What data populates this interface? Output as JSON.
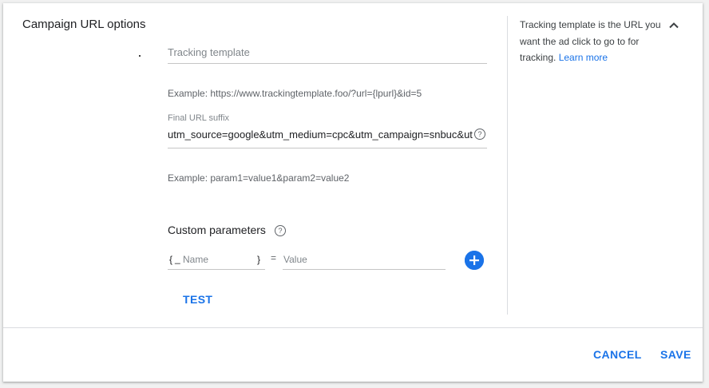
{
  "section": {
    "title": "Campaign URL options"
  },
  "tracking_template": {
    "placeholder": "Tracking template",
    "example": "Example: https://www.trackingtemplate.foo/?url={lpurl}&id=5"
  },
  "final_url_suffix": {
    "label": "Final URL suffix",
    "value": "utm_source=google&utm_medium=cpc&utm_campaign=snbuc&utm",
    "example": "Example: param1=value1&param2=value2",
    "help_icon": "question-circle-icon"
  },
  "custom_parameters": {
    "label": "Custom parameters",
    "help_icon": "question-circle-icon",
    "brace_open": "{",
    "underscore": "_",
    "name_placeholder": "Name",
    "brace_close": "}",
    "equals": "=",
    "value_placeholder": "Value",
    "add_icon": "plus-circle-icon"
  },
  "test_button": {
    "label": "TEST"
  },
  "help_panel": {
    "text": "Tracking template is the URL you want the ad click to go to for tracking. ",
    "link": "Learn more",
    "collapse_icon": "chevron-up-icon"
  },
  "footer": {
    "cancel_label": "CANCEL",
    "save_label": "SAVE"
  },
  "colors": {
    "accent": "#1a73e8",
    "divider": "#dadce0",
    "text_secondary": "#5f6368"
  }
}
